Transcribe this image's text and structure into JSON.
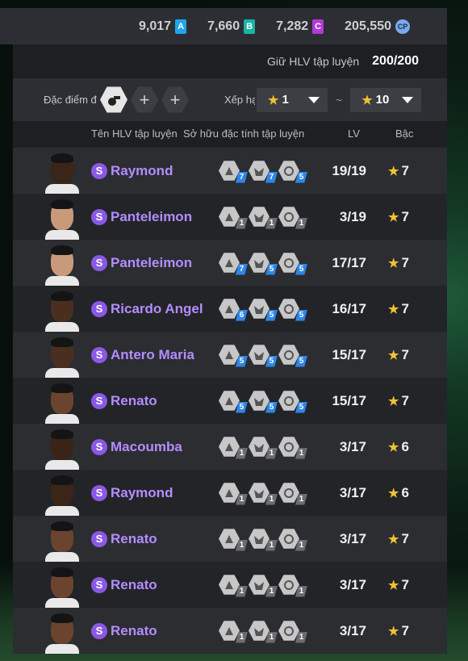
{
  "currencies": [
    {
      "value": "9,017",
      "icon": "A",
      "color": "#1fa6e8"
    },
    {
      "value": "7,660",
      "icon": "B",
      "color": "#19b5a5"
    },
    {
      "value": "7,282",
      "icon": "C",
      "color": "#b23ad6"
    },
    {
      "value": "205,550",
      "icon": "CP",
      "color": "#7aa9e8"
    }
  ],
  "capacity": {
    "label": "Giữ HLV tập luyện",
    "value": "200/200"
  },
  "filter": {
    "trait_label": "Đặc điểm đ",
    "rank_label": "Xếp hạ",
    "rank_min": "1",
    "rank_max": "10",
    "tilde": "~",
    "add_symbol": "+"
  },
  "columns": {
    "name": "Tên HLV tập luyện",
    "traits": "Sở hữu đặc tính tập luyện",
    "lv": "LV",
    "rank": "Bậc"
  },
  "badge_letter": "S",
  "star": "★",
  "rows": [
    {
      "name": "Raymond",
      "levels": [
        "7",
        "7",
        "5"
      ],
      "lv": "19/19",
      "rank": "7",
      "skin": "#3b2519"
    },
    {
      "name": "Panteleimon",
      "levels": [
        "1",
        "1",
        "1"
      ],
      "lv": "3/19",
      "rank": "7",
      "skin": "#c99a7a"
    },
    {
      "name": "Panteleimon",
      "levels": [
        "7",
        "5",
        "5"
      ],
      "lv": "17/17",
      "rank": "7",
      "skin": "#c99a7a"
    },
    {
      "name": "Ricardo Angel",
      "levels": [
        "6",
        "5",
        "5"
      ],
      "lv": "16/17",
      "rank": "7",
      "skin": "#4a2f20"
    },
    {
      "name": "Antero Maria",
      "levels": [
        "5",
        "5",
        "5"
      ],
      "lv": "15/17",
      "rank": "7",
      "skin": "#4a2f20"
    },
    {
      "name": "Renato",
      "levels": [
        "5",
        "5",
        "5"
      ],
      "lv": "15/17",
      "rank": "7",
      "skin": "#6b4430"
    },
    {
      "name": "Macoumba",
      "levels": [
        "1",
        "1",
        "1"
      ],
      "lv": "3/17",
      "rank": "6",
      "skin": "#3a2417"
    },
    {
      "name": "Raymond",
      "levels": [
        "1",
        "1",
        "1"
      ],
      "lv": "3/17",
      "rank": "6",
      "skin": "#3b2519"
    },
    {
      "name": "Renato",
      "levels": [
        "1",
        "1",
        "1"
      ],
      "lv": "3/17",
      "rank": "7",
      "skin": "#6b4430"
    },
    {
      "name": "Renato",
      "levels": [
        "1",
        "1",
        "1"
      ],
      "lv": "3/17",
      "rank": "7",
      "skin": "#6b4430"
    },
    {
      "name": "Renato",
      "levels": [
        "1",
        "1",
        "1"
      ],
      "lv": "3/17",
      "rank": "7",
      "skin": "#6b4430"
    }
  ]
}
